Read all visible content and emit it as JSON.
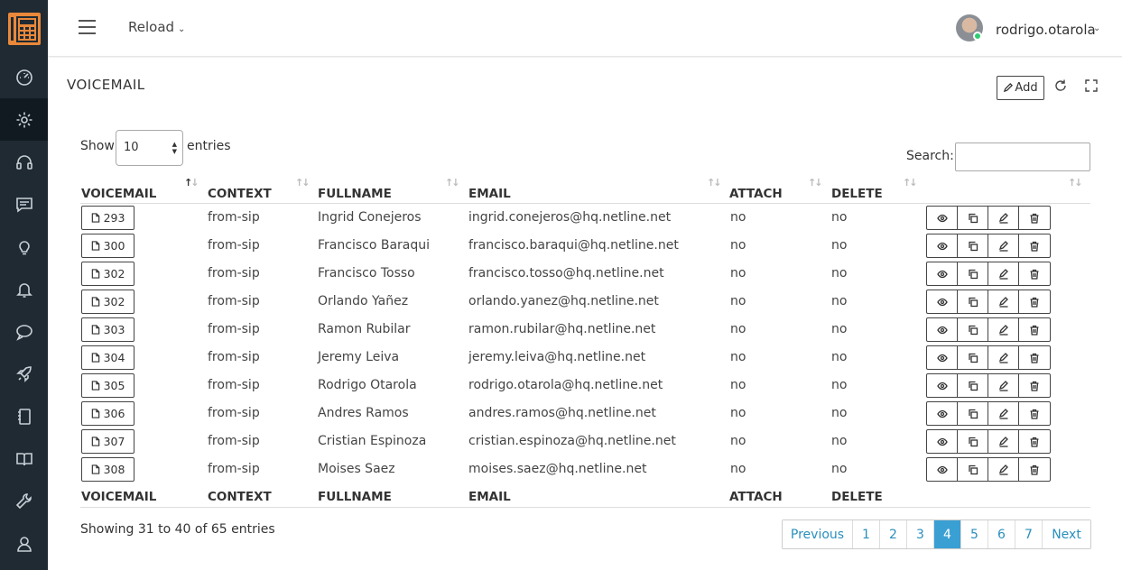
{
  "topbar": {
    "reload_label": "Reload",
    "username": "rodrigo.otarola"
  },
  "page": {
    "title": "VOICEMAIL",
    "add_label": "Add"
  },
  "controls": {
    "show_label": "Show",
    "page_length": "10",
    "entries_label": "entries",
    "search_label": "Search:"
  },
  "columns": [
    "VOICEMAIL",
    "CONTEXT",
    "FULLNAME",
    "EMAIL",
    "ATTACH",
    "DELETE"
  ],
  "rows": [
    {
      "voicemail": "293",
      "context": "from-sip",
      "fullname": "Ingrid Conejeros",
      "email": "ingrid.conejeros@hq.netline.net",
      "attach": "no",
      "delete": "no"
    },
    {
      "voicemail": "300",
      "context": "from-sip",
      "fullname": "Francisco Baraqui",
      "email": "francisco.baraqui@hq.netline.net",
      "attach": "no",
      "delete": "no"
    },
    {
      "voicemail": "302",
      "context": "from-sip",
      "fullname": "Francisco Tosso",
      "email": "francisco.tosso@hq.netline.net",
      "attach": "no",
      "delete": "no"
    },
    {
      "voicemail": "302",
      "context": "from-sip",
      "fullname": "Orlando Yañez",
      "email": "orlando.yanez@hq.netline.net",
      "attach": "no",
      "delete": "no"
    },
    {
      "voicemail": "303",
      "context": "from-sip",
      "fullname": "Ramon Rubilar",
      "email": "ramon.rubilar@hq.netline.net",
      "attach": "no",
      "delete": "no"
    },
    {
      "voicemail": "304",
      "context": "from-sip",
      "fullname": "Jeremy Leiva",
      "email": "jeremy.leiva@hq.netline.net",
      "attach": "no",
      "delete": "no"
    },
    {
      "voicemail": "305",
      "context": "from-sip",
      "fullname": "Rodrigo Otarola",
      "email": "rodrigo.otarola@hq.netline.net",
      "attach": "no",
      "delete": "no"
    },
    {
      "voicemail": "306",
      "context": "from-sip",
      "fullname": "Andres Ramos",
      "email": "andres.ramos@hq.netline.net",
      "attach": "no",
      "delete": "no"
    },
    {
      "voicemail": "307",
      "context": "from-sip",
      "fullname": "Cristian Espinoza",
      "email": "cristian.espinoza@hq.netline.net",
      "attach": "no",
      "delete": "no"
    },
    {
      "voicemail": "308",
      "context": "from-sip",
      "fullname": "Moises Saez",
      "email": "moises.saez@hq.netline.net",
      "attach": "no",
      "delete": "no"
    }
  ],
  "footer": {
    "info": "Showing 31 to 40 of 65 entries",
    "pagination": [
      "Previous",
      "1",
      "2",
      "3",
      "4",
      "5",
      "6",
      "7",
      "Next"
    ],
    "active_page": "4"
  },
  "sidebar": {
    "icons": [
      "dashboard-icon",
      "settings-icon",
      "headset-icon",
      "message-icon",
      "lightbulb-icon",
      "bell-icon",
      "chat-icon",
      "rocket-icon",
      "notebook-icon",
      "book-icon",
      "wrench-icon",
      "user-icon"
    ],
    "active": "settings-icon"
  },
  "colors": {
    "sidebar_bg": "#1f2a33",
    "logo_accent": "#e9883a",
    "active_page_bg": "#3a9fd3",
    "link": "#2a8fbd",
    "online": "#2ecc71"
  }
}
